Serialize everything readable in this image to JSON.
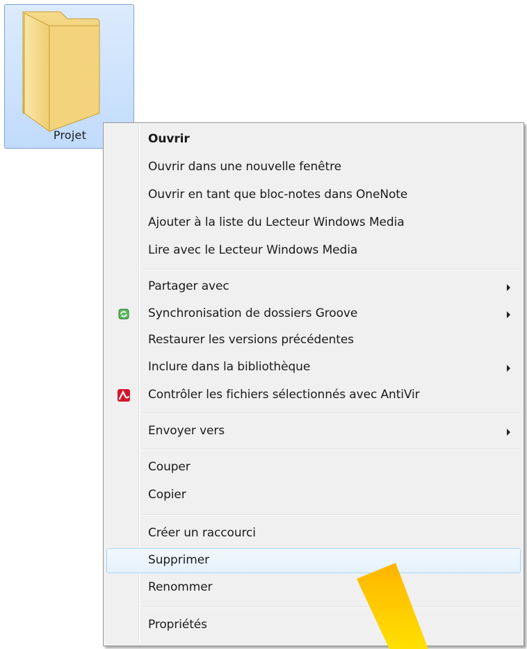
{
  "desktop": {
    "folder": {
      "label": "Projet",
      "icon": "folder-icon"
    }
  },
  "context_menu": {
    "items": [
      {
        "label": "Ouvrir",
        "bold": true
      },
      {
        "label": "Ouvrir dans une nouvelle fenêtre"
      },
      {
        "label": "Ouvrir en tant que bloc-notes dans OneNote"
      },
      {
        "label": "Ajouter à la liste du Lecteur Windows Media"
      },
      {
        "label": "Lire avec le Lecteur Windows Media"
      },
      {
        "label": "Partager avec",
        "submenu": true
      },
      {
        "label": "Synchronisation de dossiers Groove",
        "icon": "groove-sync-icon",
        "submenu": true
      },
      {
        "label": "Restaurer les versions précédentes"
      },
      {
        "label": "Inclure dans la bibliothèque",
        "submenu": true
      },
      {
        "label": "Contrôler les fichiers sélectionnés avec AntiVir",
        "icon": "antivir-icon"
      },
      {
        "label": "Envoyer vers",
        "submenu": true
      },
      {
        "label": "Couper"
      },
      {
        "label": "Copier"
      },
      {
        "label": "Créer un raccourci"
      },
      {
        "label": "Supprimer",
        "highlighted": true
      },
      {
        "label": "Renommer"
      },
      {
        "label": "Propriétés"
      }
    ]
  },
  "colors": {
    "selection_border": "#7da2ce",
    "menu_background": "#f0f0f0",
    "highlight_border": "#a8d8f5",
    "pointer_arrow": "#ffc800"
  }
}
